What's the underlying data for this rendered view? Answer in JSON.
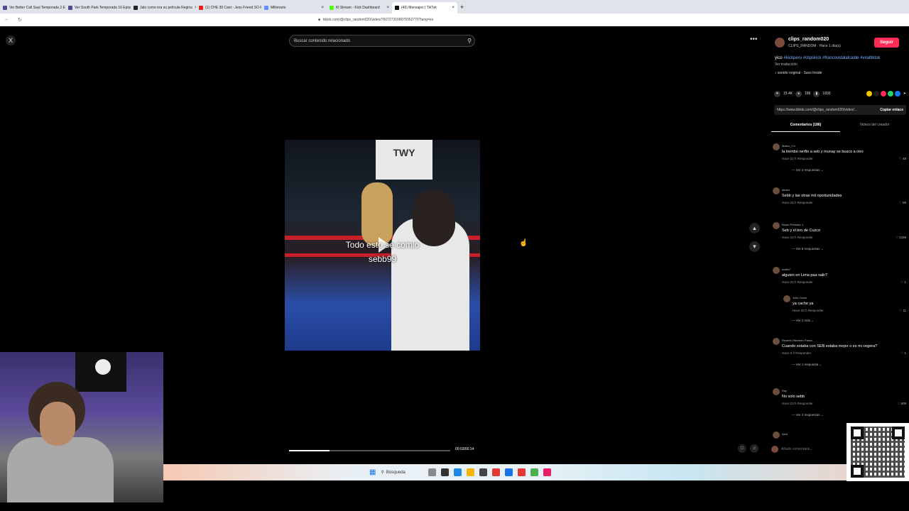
{
  "browser": {
    "tabs": [
      {
        "label": "Ver Better Call Saul Temporada 2 Epi",
        "color": "#4d4d8f"
      },
      {
        "label": "Ver South Park Temporada 16 Episo",
        "color": "#4d4d8f"
      },
      {
        "label": "Jalo como era su película Regina",
        "color": "#222"
      },
      {
        "label": "(1) CHE 39 Cant - Jess Friend SO Real",
        "color": "#e62117"
      },
      {
        "label": "Millonario",
        "color": "#6b8cff"
      },
      {
        "label": "Kl Stream - Kick Dashboard",
        "color": "#53fc18"
      },
      {
        "label": "(45) Mensajes | TikTok",
        "color": "#111",
        "active": true
      }
    ],
    "url": "tiktok.com/@clips_random020/video/7607273108079352770?lang=es"
  },
  "search": {
    "placeholder": "Buscar contenido relacionado"
  },
  "video": {
    "caption_line1": "Todo esto se comio",
    "caption_line2": "sebb99",
    "sign_text": "TWY",
    "time": "00:03/00:14",
    "progress": 0.25
  },
  "creator": {
    "username": "clips_random020",
    "subline": "CLIPS_RANDOM · Hace 1 día(s)",
    "follow_label": "Seguir",
    "description_plain": "yico",
    "hashtags": "#kickperu #clipskick #francovidalalcalde #viraltiktok",
    "translate_label": "Ver traducción",
    "sound": "sonido original - Saxx Inside"
  },
  "stats": {
    "likes": "15.4K",
    "comments": "186",
    "saves": "1830"
  },
  "share_colors": [
    "#f5c400",
    "#1d1d1d",
    "#fe2c55",
    "#25d366",
    "#1877f2"
  ],
  "link": {
    "url": "https://www.tiktok.com/@clips_random020/video/...",
    "copy_label": "Copiar enlace"
  },
  "panel_tabs": {
    "comments": "Comentarios (186)",
    "creator_videos": "Videos del creador"
  },
  "comments": [
    {
      "name": "Mateo_2.0",
      "text": "la trembo nerfio a seb y munay se busco a otro",
      "meta": "Hace 22 h   Responder",
      "likes": "48",
      "replies": "Ver 2 respuestas"
    },
    {
      "name": "aleskz",
      "text": "Sebb y las otras mil oportunidades",
      "meta": "Hace 15 h   Responder",
      "likes": "58",
      "replies": ""
    },
    {
      "name": "Bryan Pedraza :)",
      "text": "Seb y el bro de Cuzco",
      "meta": "Hace 23 h   Responder",
      "likes": "1339",
      "replies": "Ver 9 respuestas"
    },
    {
      "name": "mafia7",
      "text": "alguien en Lima paa salir?",
      "meta": "Hace 22 h   Responder",
      "likes": "1",
      "replies": ""
    },
    {
      "name": "Julio César",
      "text": "ya cache ya",
      "meta": "Hace 20 h   Responder",
      "likes": "11",
      "replies": "Ver 2 más"
    },
    {
      "name": "Ricardo Hiseman Passo",
      "text": "Cuando estaba con SEB estaba mejor o es mi cegera?",
      "meta": "Hace 5 h   Responder",
      "likes": "1",
      "replies": "Ver 1 respuesta"
    },
    {
      "name": "Ray",
      "text": "No solo sebb",
      "meta": "Hace 23 h   Responder",
      "likes": "509",
      "replies": "Ver 4 respuestas"
    },
    {
      "name": "Abel",
      "text": "",
      "meta": "",
      "likes": "",
      "replies": ""
    }
  ],
  "comment_input": {
    "placeholder": "Añadir comentario..."
  },
  "taskbar": {
    "search_label": "Búsqueda"
  },
  "close_label": "X"
}
